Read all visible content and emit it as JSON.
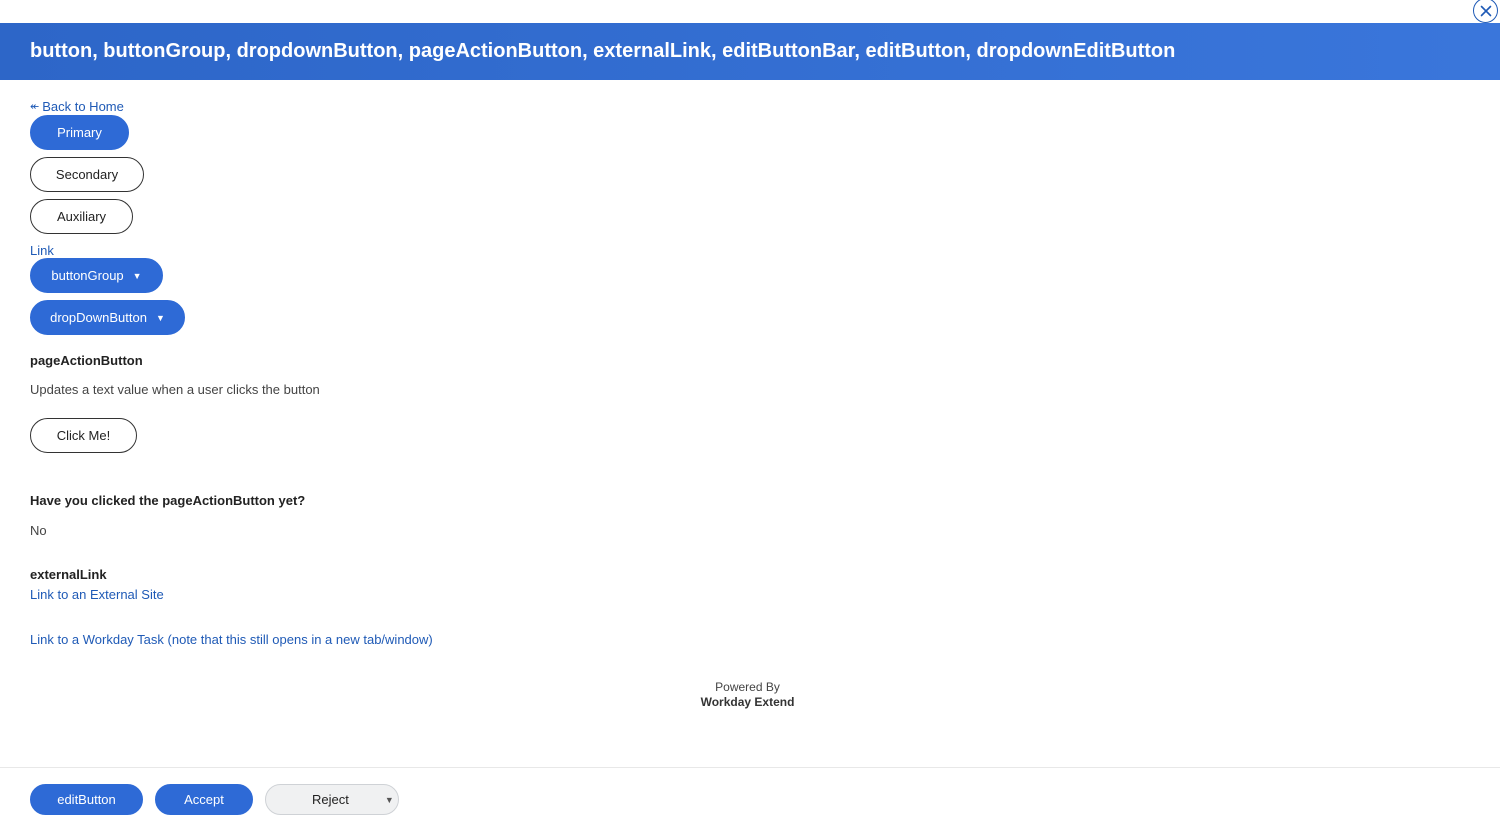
{
  "header": {
    "title": "button, buttonGroup, dropdownButton, pageActionButton, externalLink, editButtonBar, editButton, dropdownEditButton"
  },
  "nav": {
    "back_label": "Back to Home"
  },
  "buttons": {
    "primary_label": "Primary",
    "secondary_label": "Secondary",
    "auxiliary_label": "Auxiliary",
    "link_label": "Link",
    "button_group_label": "buttonGroup",
    "dropdown_button_label": "dropDownButton"
  },
  "page_action": {
    "title": "pageActionButton",
    "description": "Updates a text value when a user clicks the button",
    "button_label": "Click Me!",
    "question": "Have you clicked the pageActionButton yet?",
    "answer": "No"
  },
  "external_link": {
    "title": "externalLink",
    "site_link_label": "Link to an External Site",
    "task_link_label": "Link to a Workday Task (note that this still opens in a new tab/window)"
  },
  "powered": {
    "line1": "Powered By",
    "line2": "Workday Extend"
  },
  "footer": {
    "edit_button_label": "editButton",
    "accept_label": "Accept",
    "reject_label": "Reject"
  },
  "icons": {
    "close": "close-icon",
    "back_arrow": "back-arrow-icon",
    "caret_down": "caret-down-icon"
  },
  "colors": {
    "header_blue": "#3670d4",
    "primary_blue": "#2e6ad6",
    "link_blue": "#1f5ab6"
  }
}
